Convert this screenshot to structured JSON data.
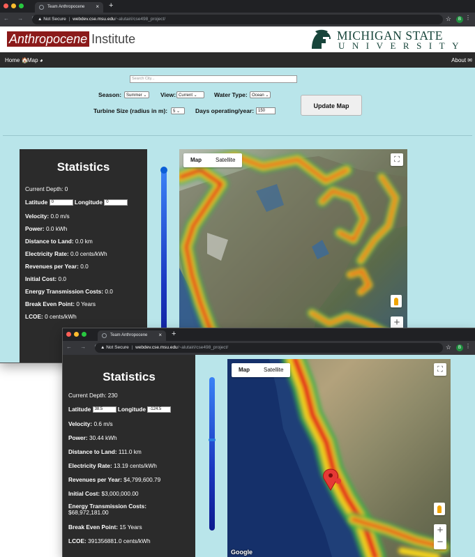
{
  "browser": {
    "tab_title": "Team Anthropocene",
    "new_tab": "+",
    "tab_close": "×",
    "nav_glyphs": "← → C",
    "security_label": "▲ Not Secure",
    "separator": "|",
    "host": "webdev.cse.msu.edu",
    "path": "/~alutairi/cse498_project/",
    "star": "☆",
    "extension_badge": "B",
    "menu": "⋮"
  },
  "header": {
    "brand_part1": "Anthropocene",
    "brand_part2": "Institute",
    "msu_line1": "MICHIGAN STATE",
    "msu_line2": "UNIVERSITY"
  },
  "nav": {
    "home": "Home",
    "home_icon": "🏠",
    "map": "Map",
    "map_icon": "◕",
    "about": "About",
    "about_icon": "✉"
  },
  "controls": {
    "search_placeholder": "Search City...",
    "season_label": "Season:",
    "season_value": "Summer ⌄",
    "view_label": "View:",
    "view_value": "Current ⌄",
    "water_label": "Water Type:",
    "water_value": "Ocean ⌄",
    "turbine_label": "Turbine Size (radius in m):",
    "turbine_value": "5 ⌄",
    "days_label": "Days operating/year:",
    "days_value": "150",
    "update_button": "Update Map"
  },
  "stats1": {
    "title": "Statistics",
    "current_depth": "Current Depth: 0",
    "latitude_label": "Latitude",
    "latitude_value": "0",
    "longitude_label": "Longitude",
    "longitude_value": "0",
    "velocity_label": "Velocity:",
    "velocity_value": "0.0 m/s",
    "power_label": "Power:",
    "power_value": "0.0 kWh",
    "distance_label": "Distance to Land:",
    "distance_value": "0.0 km",
    "rate_label": "Electricity Rate:",
    "rate_value": "0.0 cents/kWh",
    "revenue_label": "Revenues per Year:",
    "revenue_value": "0.0",
    "initial_label": "Initial Cost:",
    "initial_value": "0.0",
    "energy_label": "Energy Transmission Costs:",
    "energy_value": "0.0",
    "breakeven_label": "Break Even Point:",
    "breakeven_value": "0 Years",
    "lcoe_label": "LCOE:",
    "lcoe_value": "0 cents/kWh"
  },
  "stats2": {
    "title": "Statistics",
    "current_depth": "Current Depth: 230",
    "latitude_label": "Latitude",
    "latitude_value": "38.5",
    "longitude_label": "Longitude",
    "longitude_value": "-124.5",
    "velocity_label": "Velocity:",
    "velocity_value": "0.6 m/s",
    "power_label": "Power:",
    "power_value": "30.44 kWh",
    "distance_label": "Distance to Land:",
    "distance_value": "111.0 km",
    "rate_label": "Electricity Rate:",
    "rate_value": "13.19 cents/kWh",
    "revenue_label": "Revenues per Year:",
    "revenue_value": "$4,799,600.79",
    "initial_label": "Initial Cost:",
    "initial_value": "$3,000,000.00",
    "energy_label": "Energy Transmission Costs:",
    "energy_value": "$68,972,181.00",
    "breakeven_label": "Break Even Point:",
    "breakeven_value": "15 Years",
    "lcoe_label": "LCOE:",
    "lcoe_value": "391356881.0 cents/kWh"
  },
  "map": {
    "tab_map": "Map",
    "tab_satellite": "Satellite",
    "fullscreen_icon": "⛶",
    "zoom_in": "+",
    "zoom_out": "−",
    "attribution": "Google"
  }
}
